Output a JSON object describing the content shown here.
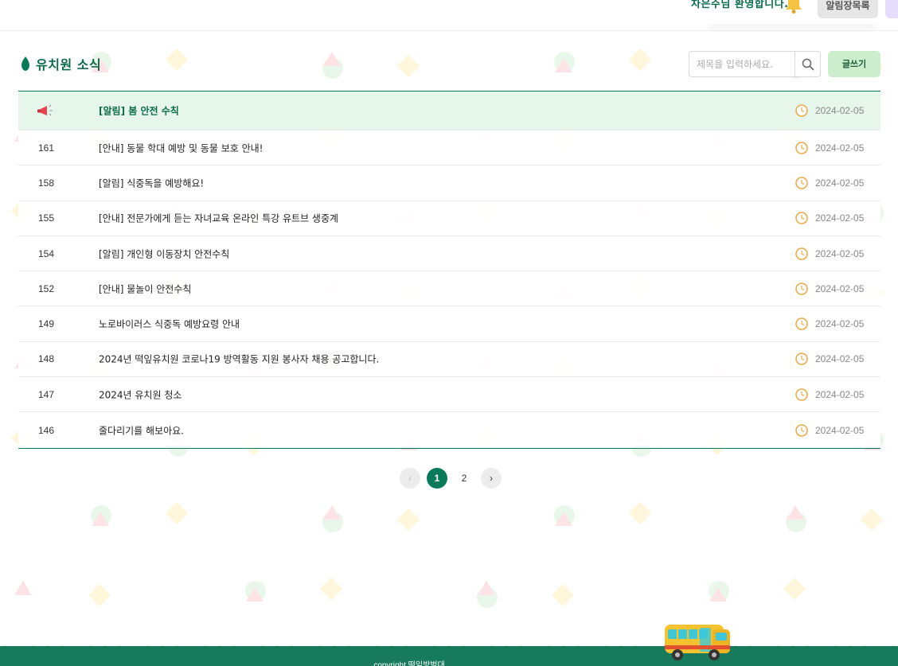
{
  "header": {
    "welcome_text": "차은주님 환영합니다.",
    "alarm_button_label": "알림장목록"
  },
  "board": {
    "title": "유치원 소식",
    "search_placeholder": "제목을 입력하세요.",
    "write_button_label": "글쓰기",
    "notice": {
      "title": "[알림] 봄 안전 수칙",
      "date": "2024-02-05"
    },
    "posts": [
      {
        "num": "161",
        "title": "[안내] 동물 학대 예방 및 동물 보호 안내!",
        "date": "2024-02-05"
      },
      {
        "num": "158",
        "title": "[알림] 식중독을 예방해요!",
        "date": "2024-02-05"
      },
      {
        "num": "155",
        "title": "[안내] 전문가에게 듣는 자녀교육 온라인 특강 유트브 생중계",
        "date": "2024-02-05"
      },
      {
        "num": "154",
        "title": "[알림] 개인형 이동장치 안전수칙",
        "date": "2024-02-05"
      },
      {
        "num": "152",
        "title": "[안내] 물놀이 안전수칙",
        "date": "2024-02-05"
      },
      {
        "num": "149",
        "title": "노로바이러스 식중독 예방요령 안내",
        "date": "2024-02-05"
      },
      {
        "num": "148",
        "title": "2024년 떡잎유치원 코로나19 방역활동 지원 봉사자 채용 공고합니다.",
        "date": "2024-02-05"
      },
      {
        "num": "147",
        "title": "2024년 유치원 청소",
        "date": "2024-02-05"
      },
      {
        "num": "146",
        "title": "줄다리기를 해보아요.",
        "date": "2024-02-05"
      }
    ]
  },
  "pagination": {
    "prev": "‹",
    "pages": [
      "1",
      "2"
    ],
    "current": "1",
    "next": "›"
  },
  "footer": {
    "copyright": "copyright 떡잎방범대"
  },
  "colors": {
    "brand_green": "#0a7a56",
    "notice_bg": "#e7f6ea",
    "write_button_bg": "#cdeecc",
    "footer_bg": "#177a5c"
  }
}
